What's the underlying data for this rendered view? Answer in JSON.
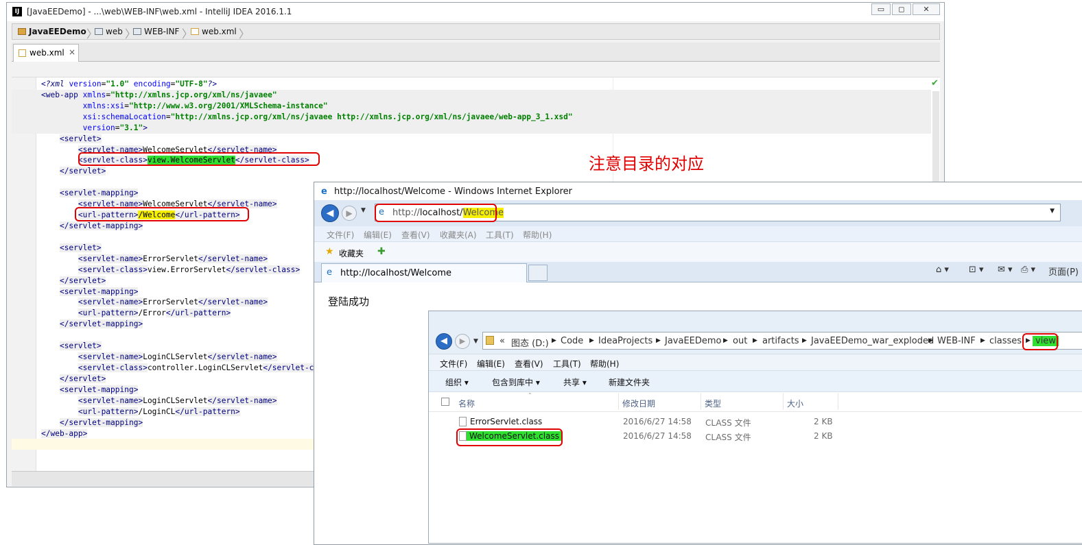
{
  "ide": {
    "logo": "IJ",
    "window_title": "[JavaEEDemo] - ...\\web\\WEB-INF\\web.xml - IntelliJ IDEA 2016.1.1",
    "window_controls": {
      "minimize": "▭",
      "maximize": "◻",
      "close": "✕"
    },
    "breadcrumb": [
      "JavaEEDemo",
      "web",
      "WEB-INF",
      "web.xml"
    ],
    "tab": {
      "label": "web.xml",
      "close": "×"
    },
    "code_lines": [
      "<?xml version=\"1.0\" encoding=\"UTF-8\"?>",
      "<web-app xmlns=\"http://xmlns.jcp.org/xml/ns/javaee\"",
      "         xmlns:xsi=\"http://www.w3.org/2001/XMLSchema-instance\"",
      "         xsi:schemaLocation=\"http://xmlns.jcp.org/xml/ns/javaee http://xmlns.jcp.org/xml/ns/javaee/web-app_3_1.xsd\"",
      "         version=\"3.1\">",
      "    <servlet>",
      "        <servlet-name>WelcomeServlet</servlet-name>",
      "        <servlet-class>view.WelcomeServlet</servlet-class>",
      "    </servlet>",
      "",
      "    <servlet-mapping>",
      "        <servlet-name>WelcomeServlet</servlet-name>",
      "        <url-pattern>/Welcome</url-pattern>",
      "    </servlet-mapping>",
      "",
      "    <servlet>",
      "        <servlet-name>ErrorServlet</servlet-name>",
      "        <servlet-class>view.ErrorServlet</servlet-class>",
      "    </servlet>",
      "    <servlet-mapping>",
      "        <servlet-name>ErrorServlet</servlet-name>",
      "        <url-pattern>/Error</url-pattern>",
      "    </servlet-mapping>",
      "",
      "    <servlet>",
      "        <servlet-name>LoginCLServlet</servlet-name>",
      "        <servlet-class>controller.LoginCLServlet</servlet-class>",
      "    </servlet>",
      "    <servlet-mapping>",
      "        <servlet-name>LoginCLServlet</servlet-name>",
      "        <url-pattern>/LoginCL</url-pattern>",
      "    </servlet-mapping>",
      "</web-app>",
      ""
    ],
    "highlight_green": "view.WelcomeServlet",
    "highlight_yellow": "/Welcome",
    "inspection_ok": "✔"
  },
  "annotation": "注意目录的对应",
  "browser": {
    "window_title": "http://localhost/Welcome - Windows Internet Explorer",
    "address_prefix": "http://",
    "address_host": "localhost/",
    "address_path": "Welcome",
    "menu": [
      "文件(F)",
      "编辑(E)",
      "查看(V)",
      "收藏夹(A)",
      "工具(T)",
      "帮助(H)"
    ],
    "favorites_label": "收藏夹",
    "tab_title": "http://localhost/Welcome",
    "page_menu": "页面(P)",
    "page_text": "登陆成功"
  },
  "explorer": {
    "path_overflow": "«",
    "path": [
      "图态 (D:)",
      "Code",
      "IdeaProjects",
      "JavaEEDemo",
      "out",
      "artifacts",
      "JavaEEDemo_war_exploded",
      "WEB-INF",
      "classes",
      "view"
    ],
    "menu": [
      "文件(F)",
      "编辑(E)",
      "查看(V)",
      "工具(T)",
      "帮助(H)"
    ],
    "toolbar": [
      "组织 ▾",
      "包含到库中 ▾",
      "共享 ▾",
      "新建文件夹"
    ],
    "columns": [
      "名称",
      "修改日期",
      "类型",
      "大小"
    ],
    "files": [
      {
        "name": "ErrorServlet.class",
        "modified": "2016/6/27 14:58",
        "type": "CLASS 文件",
        "size": "2 KB"
      },
      {
        "name": "WelcomeServlet.class",
        "modified": "2016/6/27 14:58",
        "type": "CLASS 文件",
        "size": "2 KB"
      }
    ]
  },
  "colors": {
    "annotation_red": "#e00000",
    "highlight_green": "#30e030",
    "highlight_yellow": "#f6f000"
  }
}
